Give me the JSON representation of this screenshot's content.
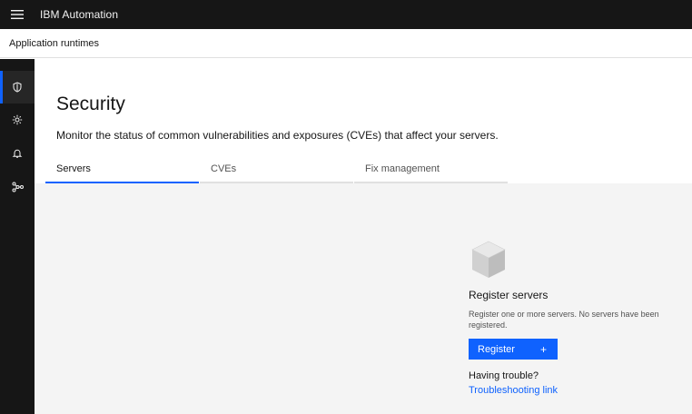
{
  "header": {
    "brand": "IBM Automation",
    "menu_icon": "hamburger-menu-icon"
  },
  "subheader": {
    "title": "Application runtimes"
  },
  "sidebar": {
    "items": [
      {
        "name": "security",
        "icon": "shield-icon",
        "active": true
      },
      {
        "name": "settings",
        "icon": "settings-adjust-icon",
        "active": false
      },
      {
        "name": "notifications",
        "icon": "bell-icon",
        "active": false
      },
      {
        "name": "topology",
        "icon": "network-icon",
        "active": false
      }
    ]
  },
  "main": {
    "title": "Security",
    "description": "Monitor the status of common vulnerabilities and exposures (CVEs) that affect your servers.",
    "tabs": [
      {
        "label": "Servers",
        "active": true
      },
      {
        "label": "CVEs",
        "active": false
      },
      {
        "label": "Fix management",
        "active": false
      }
    ],
    "empty_state": {
      "illustration": "box-icon",
      "title": "Register servers",
      "text": "Register one or more servers. No servers have been registered.",
      "button_label": "Register",
      "button_icon": "+",
      "help_text": "Having trouble?",
      "help_link": "Troubleshooting link"
    }
  },
  "colors": {
    "accent": "#0f62fe",
    "header_bg": "#161616",
    "panel_bg": "#f4f4f4"
  }
}
